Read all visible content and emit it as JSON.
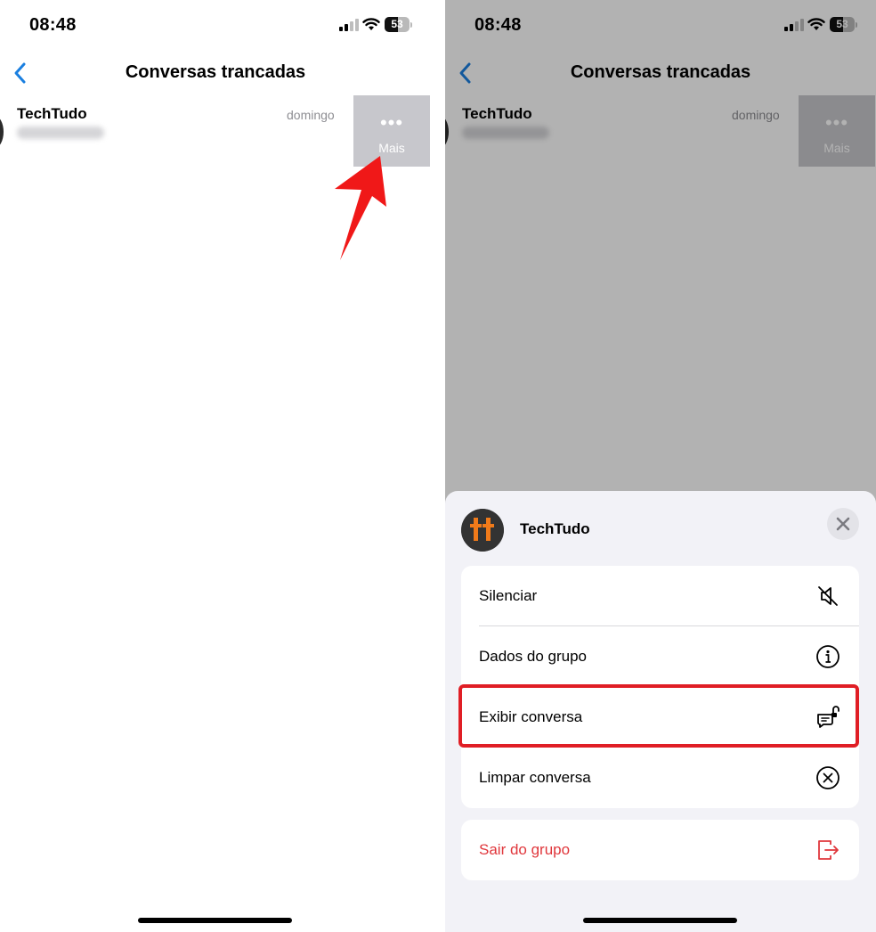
{
  "status_bar": {
    "time": "08:48",
    "battery": "53"
  },
  "nav": {
    "title": "Conversas trancadas"
  },
  "chat": {
    "name": "TechTudo",
    "date": "domingo"
  },
  "swipe_action": {
    "label": "Mais",
    "dots": "•••"
  },
  "sheet": {
    "title": "TechTudo",
    "items": [
      {
        "label": "Silenciar",
        "icon": "muted-speaker-icon"
      },
      {
        "label": "Dados do grupo",
        "icon": "info-icon"
      },
      {
        "label": "Exibir conversa",
        "icon": "unlock-chat-icon"
      },
      {
        "label": "Limpar conversa",
        "icon": "clear-circle-icon"
      }
    ],
    "exit": {
      "label": "Sair do grupo",
      "icon": "exit-icon"
    }
  },
  "colors": {
    "accent": "#1a7fe0",
    "destructive": "#e0373c",
    "annotation": "#e01e25",
    "avatar_letters": "#f07a1a"
  }
}
